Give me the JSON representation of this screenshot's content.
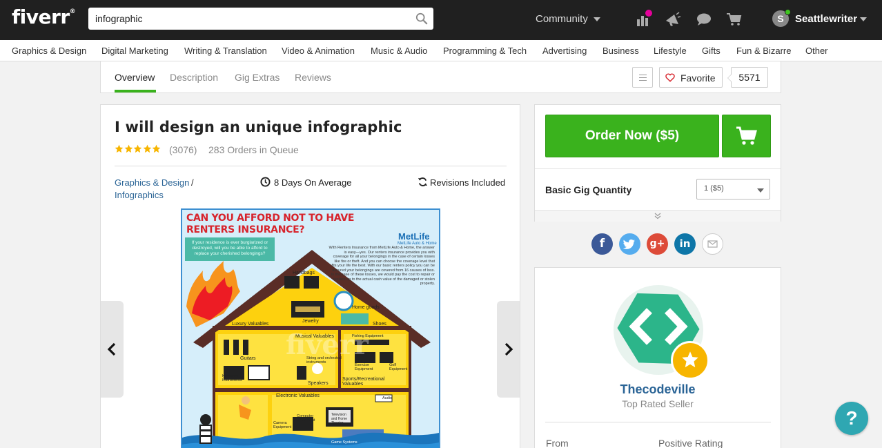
{
  "header": {
    "logo": "fiverr",
    "logo_mark": "®",
    "search_value": "infographic",
    "community_label": "Community",
    "avatar_initial": "S",
    "username": "Seattlewriter"
  },
  "categories": [
    "Graphics & Design",
    "Digital Marketing",
    "Writing & Translation",
    "Video & Animation",
    "Music & Audio",
    "Programming & Tech",
    "Advertising",
    "Business",
    "Lifestyle",
    "Gifts",
    "Fun & Bizarre",
    "Other"
  ],
  "tabs": [
    {
      "label": "Overview",
      "active": true
    },
    {
      "label": "Description",
      "active": false
    },
    {
      "label": "Gig Extras",
      "active": false
    },
    {
      "label": "Reviews",
      "active": false
    }
  ],
  "favorite": {
    "label": "Favorite",
    "count": "5571"
  },
  "gig": {
    "title": "I will design an unique infographic",
    "rating_stars": 5,
    "review_count": "(3076)",
    "orders_in_queue": "283 Orders in Queue",
    "category": "Graphics & Design",
    "category_sep": "/",
    "subcategory": "Infographics",
    "delivery": "8 Days On Average",
    "revisions": "Revisions Included"
  },
  "infographic": {
    "headline_1": "CAN YOU AFFORD NOT TO HAVE",
    "headline_2": "RENTERS INSURANCE?",
    "box_text": "If your residence is ever burglarized or destroyed, will you be able to afford to replace your cherished belongings?",
    "brand": "MetLife",
    "brand_sub": "MetLife Auto & Home",
    "body": "With Renters Insurance from MetLife Auto & Home, the answer is easy—yes. Our renters insurance provides you with coverage for all your belongings in the case of certain losses like fire or theft. And you can choose the coverage level that fits your life the best. With our basic renters policy you can be assured your belongings are covered from 16 causes of loss. In the case of these losses, we would pay the cost to repair or replace up to the actual cash value of the damaged or stolen property.",
    "labels": {
      "handbags": "Handbags",
      "home_goods": "Home goods",
      "jewelry": "Jewelry",
      "shoes": "Shoes",
      "luxury": "Luxury Valuables",
      "musical": "Musical Valuables",
      "guitars": "Guitars",
      "keyboard": "Keyboard Instruments",
      "string": "String and orchestral instruments",
      "speakers": "Speakers",
      "fishing": "Fishing Equipment",
      "fitness": "Fitness and Exercise Equipment",
      "golf": "Golf Equipment",
      "sports": "Sports/Recreational Valuables",
      "electronic": "Electronic Valuables",
      "audio": "Audio",
      "computer": "Computer Equipment",
      "camera": "Camera Equipment",
      "tv": "Television and Home Theater",
      "game": "Game Systems"
    },
    "watermark": "fiverr"
  },
  "order": {
    "button_label": "Order Now ($5)",
    "quantity_label": "Basic Gig Quantity",
    "quantity_value": "1 ($5)"
  },
  "social": {
    "facebook": "f",
    "googleplus": "g+",
    "linkedin": "in"
  },
  "seller": {
    "name": "Thecodeville",
    "level": "Top Rated Seller",
    "from_label": "From",
    "rating_label": "Positive Rating"
  },
  "help_label": "?",
  "colors": {
    "brand_green": "#3ab21d",
    "topbar": "#202020",
    "link": "#2a6496",
    "star": "#f7b500",
    "seller_hex": "#2cb58a",
    "help": "#2fa7b2"
  }
}
